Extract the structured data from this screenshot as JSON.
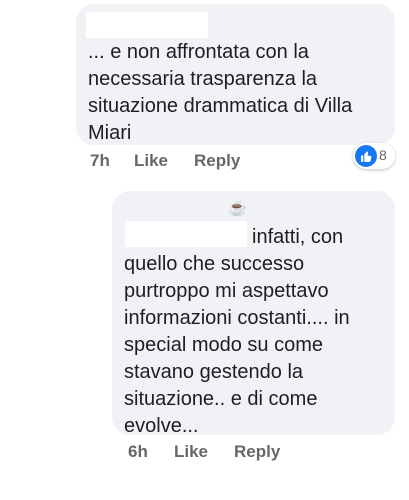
{
  "comments": [
    {
      "text": "... e non affrontata con la necessaria trasparenza la situazione drammatica di Villa Miari",
      "time": "7h",
      "like_label": "Like",
      "reply_label": "Reply",
      "reaction": {
        "icon": "like-icon",
        "count": "8"
      }
    },
    {
      "text": "infatti, con quello che successo purtroppo mi aspettavo informazioni costanti.... in special modo su come stavano gestendo la situazione.. e di come evolve...",
      "time": "6h",
      "like_label": "Like",
      "reply_label": "Reply",
      "badge_icon": "coffee-icon"
    }
  ],
  "colors": {
    "bubble": "#f0f2f5",
    "meta_text": "#65676b",
    "like_blue": "#1877f2"
  }
}
